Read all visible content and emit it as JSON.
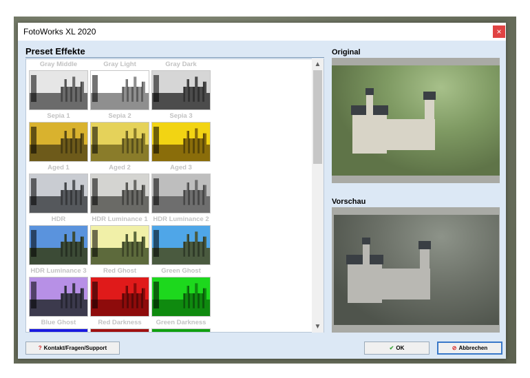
{
  "window": {
    "title": "FotoWorks XL 2020",
    "close_glyph": "×"
  },
  "sections": {
    "preset_title": "Preset Effekte",
    "original_title": "Original",
    "preview_title": "Vorschau"
  },
  "presets": [
    {
      "label": "Gray Middle",
      "sky": "#e6e6e6",
      "ground": "#6b6b6b"
    },
    {
      "label": "Gray Light",
      "sky": "#ffffff",
      "ground": "#8f8f8f"
    },
    {
      "label": "Gray Dark",
      "sky": "#d6d6d6",
      "ground": "#4c4c4c"
    },
    {
      "label": "Sepia 1",
      "sky": "#d9b22e",
      "ground": "#6d5a1a"
    },
    {
      "label": "Sepia 2",
      "sky": "#e5d25a",
      "ground": "#8a7c2a"
    },
    {
      "label": "Sepia 3",
      "sky": "#f2d413",
      "ground": "#8a6d0a"
    },
    {
      "label": "Aged 1",
      "sky": "#c9ccd2",
      "ground": "#55585c"
    },
    {
      "label": "Aged 2",
      "sky": "#d4d4d1",
      "ground": "#6a6a66"
    },
    {
      "label": "Aged 3",
      "sky": "#bebebe",
      "ground": "#6e6e6e"
    },
    {
      "label": "HDR",
      "sky": "#5a93dd",
      "ground": "#3c4b36"
    },
    {
      "label": "HDR Luminance 1",
      "sky": "#f1f0a8",
      "ground": "#5d6a3c"
    },
    {
      "label": "HDR Luminance 2",
      "sky": "#4fa6e8",
      "ground": "#4a5a3f"
    },
    {
      "label": "HDR Luminance 3",
      "sky": "#b790e6",
      "ground": "#3c3a4d"
    },
    {
      "label": "Red Ghost",
      "sky": "#e01a1a",
      "ground": "#8e0b0b"
    },
    {
      "label": "Green Ghost",
      "sky": "#1dd81d",
      "ground": "#0f8a0f"
    },
    {
      "label": "Blue Ghost",
      "sky": "#1a1ae0",
      "ground": "#0b0b8e"
    },
    {
      "label": "Red Darkness",
      "sky": "#a01010",
      "ground": "#500808"
    },
    {
      "label": "Green Darkness",
      "sky": "#10a010",
      "ground": "#085008"
    }
  ],
  "scrollbar": {
    "up_glyph": "▲",
    "down_glyph": "▼"
  },
  "buttons": {
    "support_icon": "?",
    "support_label": "Kontakt/Fragen/Support",
    "ok_icon": "✔",
    "ok_label": "OK",
    "cancel_icon": "⊘",
    "cancel_label": "Abbrechen"
  },
  "colors": {
    "accent": "#3877c8",
    "close_red": "#e04343",
    "dialog_bg": "#dce8f5"
  }
}
